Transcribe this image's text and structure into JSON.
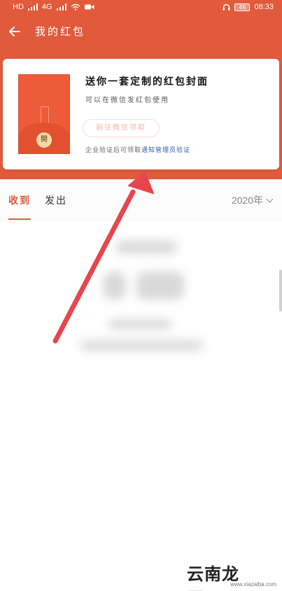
{
  "status_bar": {
    "carrier_left_1": "HD",
    "carrier_left_2": "4G",
    "battery": "46",
    "time": "08:33"
  },
  "header": {
    "back_icon": "arrow-left-icon",
    "title": "我的红包"
  },
  "promo_card": {
    "title": "送你一套定制的红包封面",
    "subtitle": "可以在微信发红包使用",
    "button_label": "前往微信领取",
    "verify_text": "企业验证后可领取",
    "verify_link": "通知管理员验证",
    "cover_seal": "開"
  },
  "tabs": {
    "received": "收到",
    "sent": "发出",
    "year": "2020年"
  },
  "watermark": {
    "brand": "云南龙网",
    "url": "www.xiazaiba.com"
  },
  "colors": {
    "accent": "#e15a3b",
    "link": "#2d5fa8",
    "annotation_arrow": "#e8454e"
  }
}
